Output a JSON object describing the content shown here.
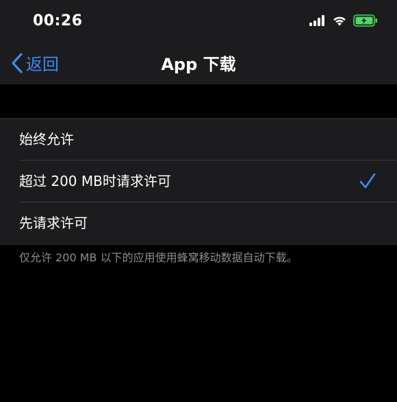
{
  "status_bar": {
    "time": "00:26",
    "icons": [
      "cellular-signal-icon",
      "wifi-icon",
      "battery-charging-icon"
    ],
    "battery_color": "#4cd964"
  },
  "nav": {
    "back_label": "返回",
    "title": "App 下载"
  },
  "options": [
    {
      "label": "始终允许",
      "selected": false
    },
    {
      "label": "超过 200 MB时请求许可",
      "selected": true
    },
    {
      "label": "先请求许可",
      "selected": false
    }
  ],
  "footer_note": "仅允许 200 MB 以下的应用使用蜂窝移动数据自动下载。",
  "colors": {
    "accent": "#3d8bf7",
    "background": "#000000",
    "group_background": "#1c1c1e",
    "secondary_text": "#8e8e93"
  }
}
